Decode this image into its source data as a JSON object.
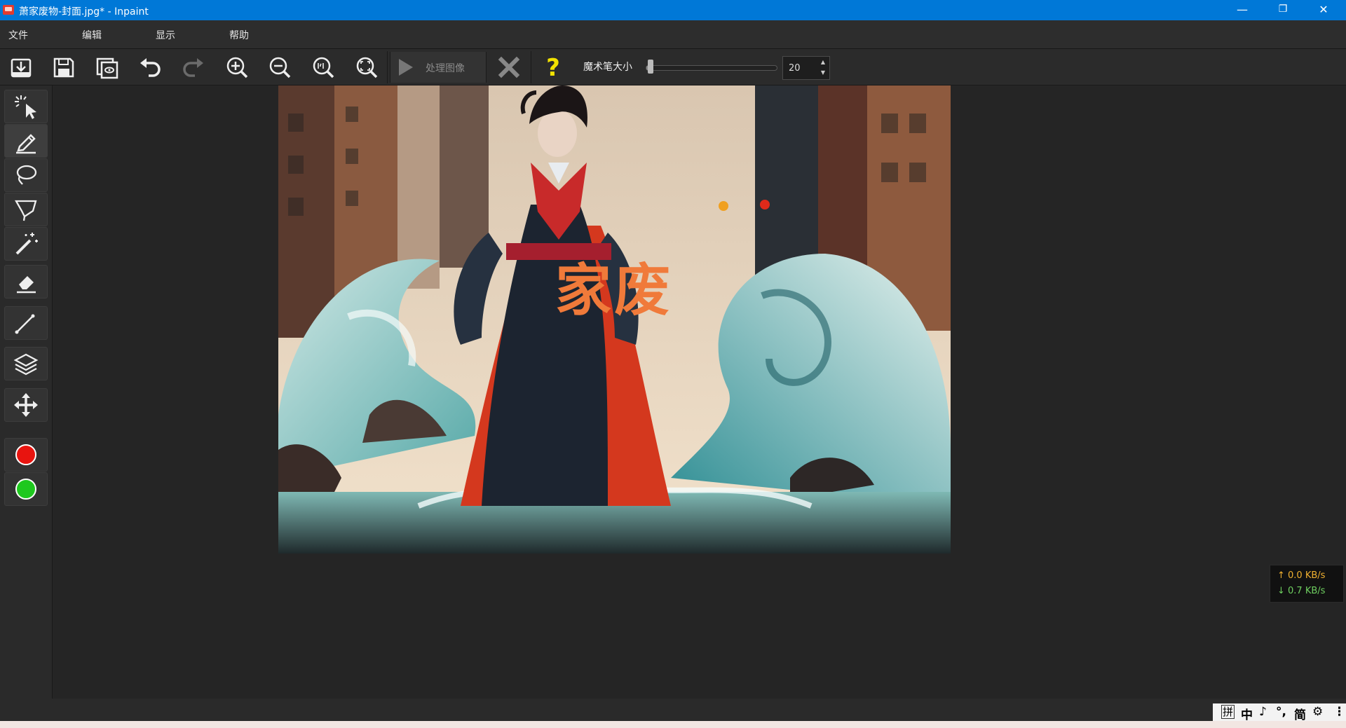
{
  "window": {
    "title": "萧家废物-封面.jpg* - Inpaint"
  },
  "window_controls": {
    "minimize": "—",
    "maximize": "❐",
    "close": "✕"
  },
  "menu": {
    "items": [
      "文件",
      "编辑",
      "显示",
      "帮助"
    ]
  },
  "toolbar": {
    "icons": [
      "open-icon",
      "save-icon",
      "save-copy-icon",
      "undo-icon",
      "redo-icon",
      "zoom-in-icon",
      "zoom-out-icon",
      "actual-size-icon",
      "fit-screen-icon"
    ],
    "process_label": "处理图像",
    "brush_size_label": "魔术笔大小",
    "brush_size_value": "20",
    "brush_size_fraction": 0.02,
    "spin_up": "▲",
    "spin_down": "▼",
    "help_glyph": "?"
  },
  "tools": {
    "items": [
      "magic-select-icon",
      "marker-icon",
      "lasso-icon",
      "polygon-lasso-icon",
      "magic-wand-icon",
      "eraser-icon",
      "line-icon",
      "layers-icon",
      "move-icon"
    ],
    "selected": "marker-icon",
    "colors": {
      "red_marker": "#e8140f",
      "green_marker": "#1ec81e"
    }
  },
  "image": {
    "watermark_text": "家废"
  },
  "network": {
    "upload": "↑ 0.0 KB/s",
    "download": "↓ 0.7 KB/s"
  },
  "ime": {
    "items": [
      "拼",
      "中",
      "♪",
      "°,",
      "简",
      "⚙",
      "⋮"
    ]
  },
  "colors": {
    "titlebar": "#0078d7",
    "accent_help": "#f2e200",
    "cancel": "#888888"
  }
}
